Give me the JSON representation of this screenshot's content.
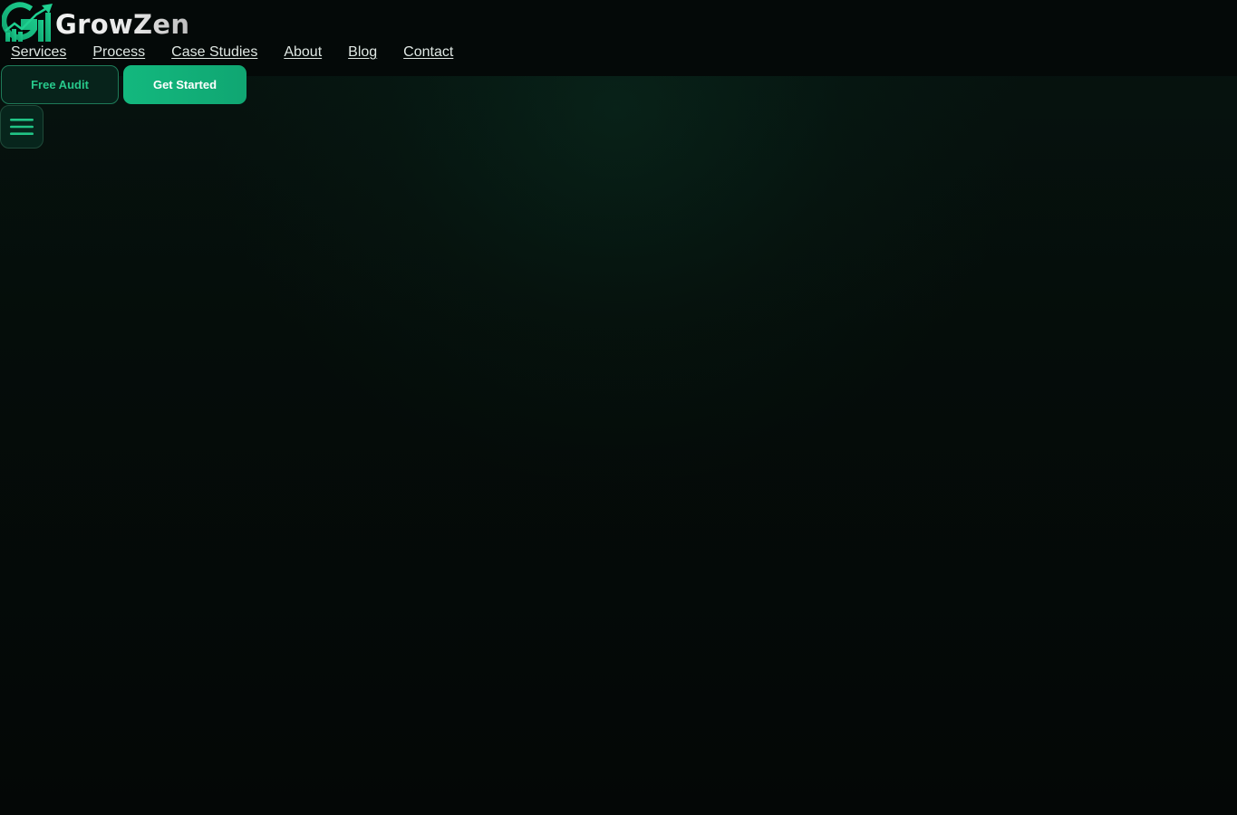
{
  "brand": {
    "name": "GrowZen",
    "accent": "#13b87e",
    "logo_icon": "growth-chart-logo-icon"
  },
  "nav": {
    "items": [
      {
        "label": "Services"
      },
      {
        "label": "Process"
      },
      {
        "label": "Case Studies"
      },
      {
        "label": "About"
      },
      {
        "label": "Blog"
      },
      {
        "label": "Contact"
      }
    ]
  },
  "cta": {
    "free_audit_label": "Free Audit",
    "get_started_label": "Get Started"
  },
  "menu": {
    "icon": "hamburger-menu-icon"
  },
  "colors": {
    "background": "#040706",
    "nav_text": "#dfe7e3",
    "accent_text": "#27c88b"
  }
}
